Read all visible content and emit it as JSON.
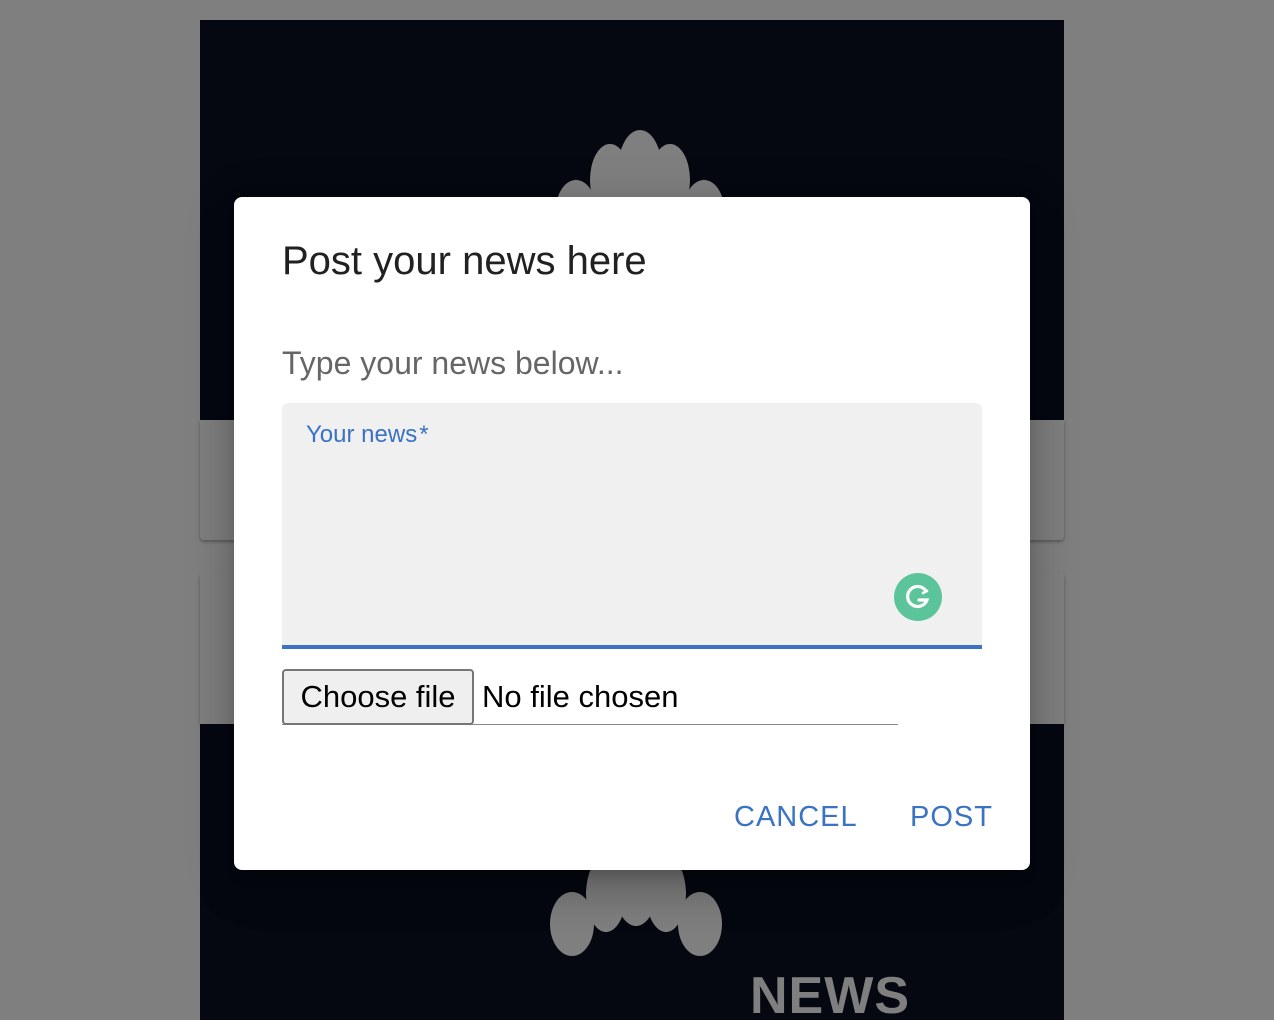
{
  "background": {
    "image_brand_text": "NEWS",
    "image_background_color": "#0a1020"
  },
  "dialog": {
    "title": "Post your news here",
    "content_text": "Type your news below...",
    "news_field": {
      "label": "Your news",
      "required_marker": "*",
      "value": "",
      "accent_color": "#3a72c4"
    },
    "grammarly_icon": "grammarly-icon",
    "file_input": {
      "button_label": "Choose file",
      "status": "No file chosen"
    },
    "actions": {
      "cancel_label": "CANCEL",
      "post_label": "POST"
    }
  }
}
